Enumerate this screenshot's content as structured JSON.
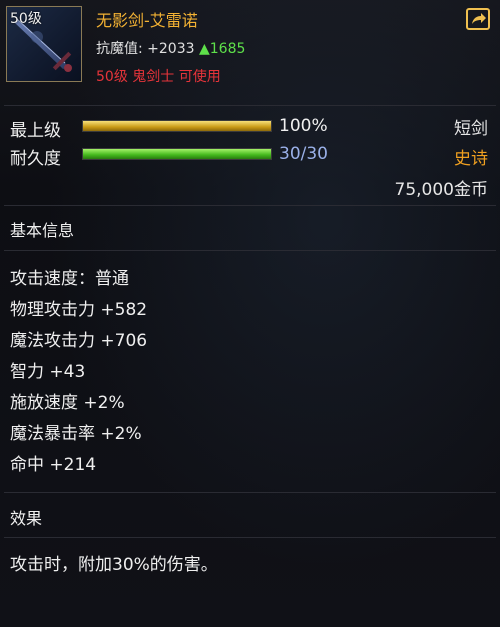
{
  "item": {
    "level_tag": "50级",
    "name": "无影剑-艾雷诺",
    "magic_res_label": "抗魔值:",
    "magic_res_value": "+2033",
    "magic_res_gain": "▲1685",
    "requirement": "50级 鬼剑士 可使用"
  },
  "grade": {
    "label": "最上级",
    "percent_text": "100%",
    "fill": 1.0,
    "weapon_type": "短剑"
  },
  "durability": {
    "label": "耐久度",
    "value_text": "30/30",
    "fill": 1.0,
    "rarity": "史诗"
  },
  "price": "75,000金币",
  "basic": {
    "title": "基本信息",
    "stats": [
      "攻击速度：普通",
      "物理攻击力 +582",
      "魔法攻击力 +706",
      "智力 +43",
      "施放速度 +2%",
      "魔法暴击率 +2%",
      "命中 +214"
    ]
  },
  "effect": {
    "title": "效果",
    "text": "攻击时，附加30%的伤害。"
  },
  "colors": {
    "name": "#f3b233",
    "requirement": "#e5343a",
    "percent": "#f0f0f0",
    "durability_text": "#9ab0e8",
    "rarity": "#f0a020",
    "gain": "#5ee04a"
  },
  "icons": {
    "share": "share-icon",
    "item": "sword-icon"
  }
}
